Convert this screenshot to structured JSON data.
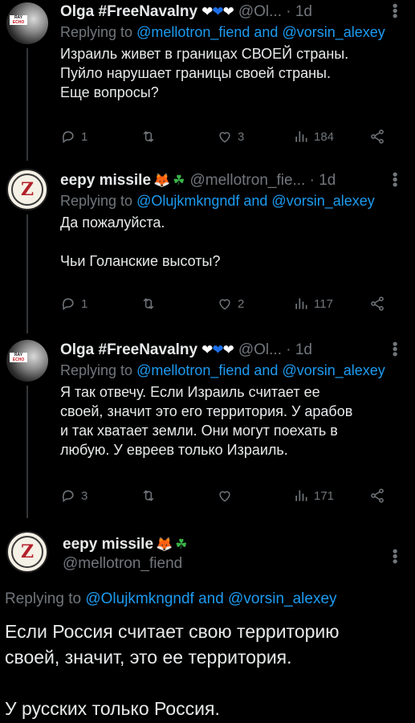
{
  "tweets": [
    {
      "author": "Olga #FreeNavalny",
      "hearts": [
        "♡",
        "♥",
        "♡"
      ],
      "handle_time": "@Ol... · 1d",
      "replying_prefix": "Replying to ",
      "replying_links": "@mellotron_fiend and @vorsin_alexey",
      "text": "Израиль живет в границах СВОЕЙ страны.\nПуйло нарушает границы своей страны.\nЕще вопросы?",
      "replies": "1",
      "retweets": "",
      "likes": "3",
      "views": "184"
    },
    {
      "author": "eepy missile",
      "handle_time": "@mellotron_fie... · 1d",
      "replying_prefix": "Replying to ",
      "replying_links": "@Olujkmkngndf and @vorsin_alexey",
      "text": "Да пожалуйста.\n\nЧьи Голанские высоты?",
      "replies": "1",
      "retweets": "",
      "likes": "2",
      "views": "117"
    },
    {
      "author": "Olga #FreeNavalny",
      "hearts": [
        "♡",
        "♥",
        "♡"
      ],
      "handle_time": "@Ol... · 1d",
      "replying_prefix": "Replying to ",
      "replying_links": "@mellotron_fiend and @vorsin_alexey",
      "text": "Я так отвечу. Если Израиль считает ее\nсвоей, значит это его территория. У арабов\nи так хватает земли. Они могут поехать в\nлюбую. У евреев только Израиль.",
      "replies": "3",
      "retweets": "",
      "likes": "",
      "views": "171"
    }
  ],
  "main": {
    "author": "eepy missile",
    "handle": "@mellotron_fiend",
    "replying_prefix": "Replying to ",
    "replying_links": "@Olujkmkngndf and @vorsin_alexey",
    "text": "Если Россия считает свою территорию\nсвоей, значит, это ее территория.\n\nУ русских только Россия."
  },
  "colors": {
    "background": "#000000",
    "text": "#e7e9ea",
    "muted": "#71767b",
    "link": "#1d9bf0"
  },
  "icons": {
    "reply": "reply-icon",
    "retweet": "retweet-icon",
    "like": "heart-icon",
    "views": "views-icon",
    "share": "share-icon",
    "more": "more-icon"
  }
}
